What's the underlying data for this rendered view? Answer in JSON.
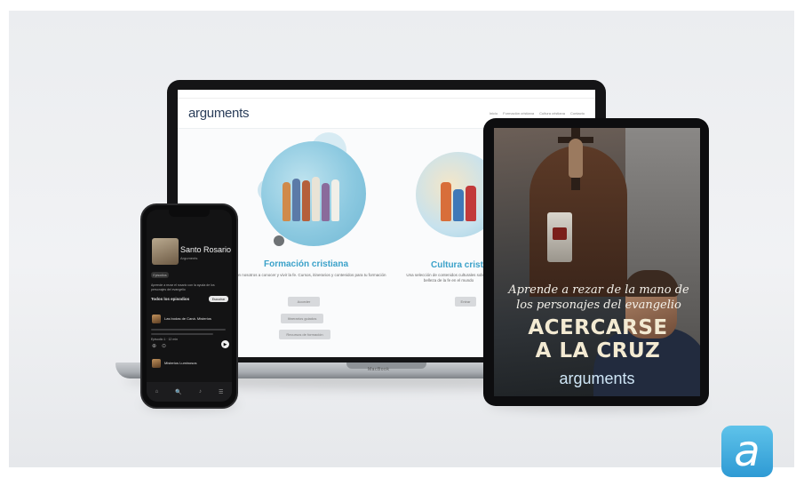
{
  "laptop": {
    "site_logo": "arguments",
    "nav_items": [
      "Inicio",
      "Formación cristiana",
      "Cultura cristiana",
      "Contacto"
    ],
    "cards": [
      {
        "title": "Formación cristiana",
        "text": "Aprende con nosotros a conocer y vivir la fe. Cursos, itinerarios y contenidos para tu formación",
        "buttons": [
          "Acceder",
          "Itinerarios guiados",
          "Recursos de formación"
        ]
      },
      {
        "title": "Cultura cristiana",
        "text": "Una selección de contenidos culturales sobre la belleza de la fe en el mundo",
        "buttons": [
          "Entrar"
        ]
      }
    ],
    "base_label": "MacBook"
  },
  "phone": {
    "title": "Santo Rosario",
    "subtitle": "Arguments",
    "pill": "Episodios",
    "description": "Aprende a rezar el rosario con la ayuda de los personajes del evangelio",
    "section_label": "Todos los episodios",
    "section_button": "Escuchar",
    "episode_1": "Las bodas de Caná. Misterios",
    "episode_meta": "Episodio 1 · 12 min",
    "player_title": "Misterios Luminosos",
    "tabs": [
      "⌂",
      "🔍",
      "♪",
      "☰"
    ]
  },
  "tablet": {
    "script_text": "Aprende a rezar de la mano de los personajes del evangelio",
    "headline_line1": "ACERCARSE",
    "headline_line2": "A LA CRUZ",
    "logo": "arguments"
  },
  "app_icon": {
    "letter": "a"
  },
  "colors": {
    "accent": "#3aa1c9",
    "icon_blue": "#2e9ad4",
    "laptop_frame": "#141416"
  }
}
